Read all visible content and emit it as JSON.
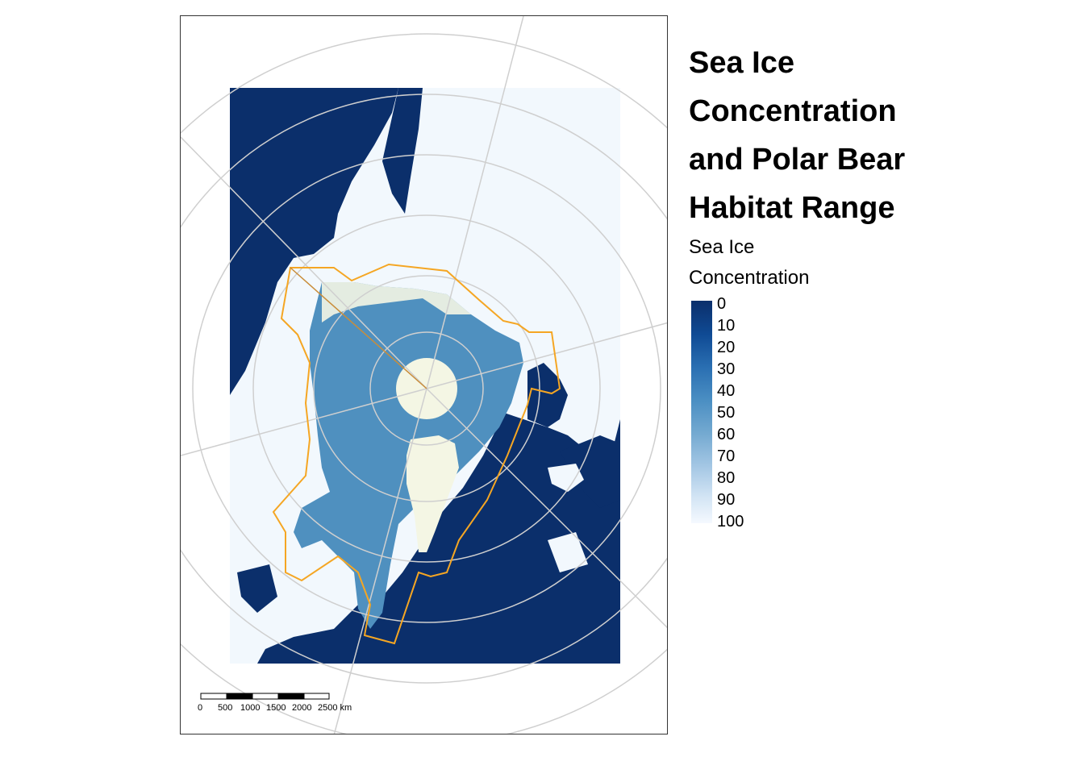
{
  "legend": {
    "title_lines": [
      "Sea Ice",
      "Concentration",
      "and Polar Bear",
      "Habitat Range"
    ],
    "subtitle_lines": [
      "Sea Ice",
      "Concentration"
    ],
    "ticks": [
      "0",
      "10",
      "20",
      "30",
      "40",
      "50",
      "60",
      "70",
      "80",
      "90",
      "100"
    ]
  },
  "scalebar": {
    "labels": [
      "0",
      "500",
      "1000",
      "1500",
      "2000",
      "2500 km"
    ]
  },
  "colors": {
    "land": "#0b2f6b",
    "ocean_ice": "#f2f8fd",
    "sea_ice": "#4f90bf",
    "pole_hole": "#f4f6e4",
    "habitat_line": "#f5a623",
    "graticule": "#cfcfcf"
  }
}
